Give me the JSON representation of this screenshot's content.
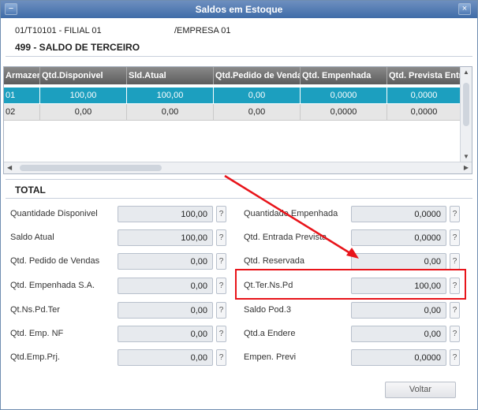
{
  "window": {
    "title": "Saldos em Estoque"
  },
  "header": {
    "product": "01/T10101 - FILIAL 01",
    "company": "/EMPRESA 01",
    "section": "499 - SALDO DE TERCEIRO"
  },
  "grid": {
    "columns": [
      "Armazem",
      "Qtd.Disponivel",
      "Sld.Atual",
      "Qtd.Pedido de Vendas",
      "Qtd. Empenhada",
      "Qtd. Prevista Entrada"
    ],
    "rows": [
      [
        "01",
        "100,00",
        "100,00",
        "0,00",
        "0,0000",
        "0,0000"
      ],
      [
        "02",
        "0,00",
        "0,00",
        "0,00",
        "0,0000",
        "0,0000"
      ]
    ]
  },
  "total": {
    "title": "TOTAL",
    "left": [
      {
        "label": "Quantidade Disponivel",
        "value": "100,00"
      },
      {
        "label": "Saldo Atual",
        "value": "100,00"
      },
      {
        "label": "Qtd. Pedido de Vendas",
        "value": "0,00"
      },
      {
        "label": "Qtd. Empenhada S.A.",
        "value": "0,00"
      },
      {
        "label": "Qt.Ns.Pd.Ter",
        "value": "0,00"
      },
      {
        "label": "Qtd. Emp. NF",
        "value": "0,00"
      },
      {
        "label": "Qtd.Emp.Prj.",
        "value": "0,00"
      }
    ],
    "right": [
      {
        "label": "Quantidade Empenhada",
        "value": "0,0000"
      },
      {
        "label": "Qtd. Entrada Prevista",
        "value": "0,0000"
      },
      {
        "label": "Qtd. Reservada",
        "value": "0,00"
      },
      {
        "label": "Qt.Ter.Ns.Pd",
        "value": "100,00"
      },
      {
        "label": "Saldo Pod.3",
        "value": "0,00"
      },
      {
        "label": "Qtd.a Endere",
        "value": "0,00"
      },
      {
        "label": "Empen. Previ",
        "value": "0,0000"
      }
    ],
    "help_label": "?"
  },
  "buttons": {
    "back": "Voltar"
  },
  "colors": {
    "selected_row": "#1c9fbf",
    "highlight": "#e8141a"
  }
}
